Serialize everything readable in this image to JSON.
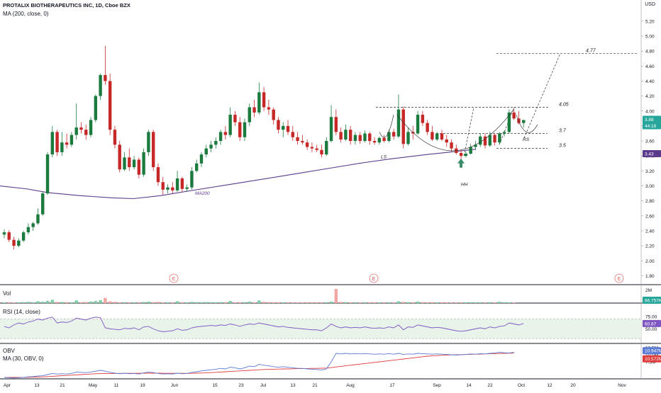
{
  "header": {
    "title": "PROTALIX BIOTHERAPEUTICS INC, 1D, Cboe BZX",
    "ma_label": "MA (200, close, 0)",
    "currency": "USD"
  },
  "panes": {
    "volume_label": "Vol",
    "rsi_label": "RSI (14, close)",
    "obv_label": "OBV",
    "obv_ma_label": "MA (30, OBV, 0)"
  },
  "colors": {
    "up": "#26a69a",
    "up_fill": "#1b7a3e",
    "down": "#ef5350",
    "down_fill": "#c62828",
    "ma200": "#5b3a8c",
    "rsi_line": "#7e57c2",
    "rsi_band": "#e8f3ea",
    "obv": "#5b7bd5",
    "obv_ma": "#e03b3b",
    "arrow": "#3a8f6a"
  },
  "chart_data": [
    {
      "type": "candlestick",
      "title": "PROTALIX BIOTHERAPEUTICS INC, 1D, Cboe BZX",
      "ylim": [
        1.7,
        5.35
      ],
      "y_ticks": [
        "5.20",
        "5.00",
        "4.80",
        "4.60",
        "4.40",
        "4.20",
        "4.00",
        "3.80",
        "3.60",
        "3.40",
        "3.20",
        "3.00",
        "2.80",
        "2.60",
        "2.40",
        "2.20",
        "2.00",
        "1.80"
      ],
      "x_ticks": [
        "Apr",
        "13",
        "21",
        "May",
        "11",
        "19",
        "Jun",
        "15",
        "23",
        "Jul",
        "13",
        "21",
        "Aug",
        "17",
        "Sep",
        "14",
        "22",
        "Oct",
        "12",
        "20",
        "Nov"
      ],
      "candles": [
        [
          2.35,
          2.42,
          2.3,
          2.38
        ],
        [
          2.38,
          2.41,
          2.25,
          2.28
        ],
        [
          2.28,
          2.32,
          2.15,
          2.2
        ],
        [
          2.2,
          2.3,
          2.18,
          2.27
        ],
        [
          2.27,
          2.4,
          2.25,
          2.38
        ],
        [
          2.38,
          2.5,
          2.35,
          2.45
        ],
        [
          2.45,
          2.52,
          2.4,
          2.5
        ],
        [
          2.5,
          2.7,
          2.48,
          2.62
        ],
        [
          2.62,
          2.92,
          2.6,
          2.9
        ],
        [
          2.9,
          3.45,
          2.88,
          3.42
        ],
        [
          3.42,
          3.8,
          3.38,
          3.72
        ],
        [
          3.72,
          3.75,
          3.4,
          3.45
        ],
        [
          3.45,
          3.72,
          3.4,
          3.58
        ],
        [
          3.58,
          3.7,
          3.5,
          3.55
        ],
        [
          3.55,
          3.72,
          3.52,
          3.68
        ],
        [
          3.68,
          4.1,
          3.62,
          3.78
        ],
        [
          3.78,
          3.85,
          3.7,
          3.75
        ],
        [
          3.75,
          3.82,
          3.62,
          3.68
        ],
        [
          3.68,
          3.92,
          3.65,
          3.88
        ],
        [
          3.88,
          4.22,
          3.85,
          4.2
        ],
        [
          4.2,
          4.5,
          4.15,
          4.48
        ],
        [
          4.48,
          4.87,
          4.35,
          4.4
        ],
        [
          4.4,
          4.5,
          3.68,
          3.75
        ],
        [
          3.75,
          3.8,
          3.5,
          3.55
        ],
        [
          3.55,
          3.6,
          3.18,
          3.22
        ],
        [
          3.22,
          3.45,
          3.2,
          3.38
        ],
        [
          3.38,
          3.5,
          3.2,
          3.25
        ],
        [
          3.25,
          3.4,
          3.22,
          3.35
        ],
        [
          3.35,
          3.38,
          3.1,
          3.15
        ],
        [
          3.15,
          3.5,
          3.12,
          3.45
        ],
        [
          3.45,
          3.75,
          3.4,
          3.72
        ],
        [
          3.72,
          3.75,
          3.2,
          3.25
        ],
        [
          3.25,
          3.3,
          3.0,
          3.05
        ],
        [
          3.05,
          3.12,
          2.88,
          2.95
        ],
        [
          2.95,
          3.02,
          2.9,
          2.98
        ],
        [
          2.98,
          3.05,
          2.9,
          2.94
        ],
        [
          2.94,
          3.2,
          2.92,
          3.1
        ],
        [
          3.1,
          3.12,
          2.92,
          2.96
        ],
        [
          2.96,
          3.02,
          2.92,
          2.98
        ],
        [
          2.98,
          3.25,
          2.95,
          3.2
        ],
        [
          3.2,
          3.35,
          3.18,
          3.3
        ],
        [
          3.3,
          3.45,
          3.25,
          3.42
        ],
        [
          3.42,
          3.55,
          3.38,
          3.5
        ],
        [
          3.5,
          3.6,
          3.45,
          3.55
        ],
        [
          3.55,
          3.65,
          3.5,
          3.6
        ],
        [
          3.6,
          3.75,
          3.55,
          3.72
        ],
        [
          3.72,
          3.8,
          3.62,
          3.68
        ],
        [
          3.68,
          4.05,
          3.65,
          3.95
        ],
        [
          3.95,
          4.0,
          3.8,
          3.85
        ],
        [
          3.85,
          3.92,
          3.6,
          3.65
        ],
        [
          3.65,
          3.9,
          3.6,
          3.85
        ],
        [
          3.85,
          4.1,
          3.8,
          4.05
        ],
        [
          4.05,
          4.15,
          3.92,
          3.98
        ],
        [
          3.98,
          4.38,
          3.95,
          4.25
        ],
        [
          4.25,
          4.32,
          4.0,
          4.05
        ],
        [
          4.05,
          4.15,
          3.95,
          4.02
        ],
        [
          4.02,
          4.05,
          3.82,
          3.88
        ],
        [
          3.88,
          3.92,
          3.7,
          3.75
        ],
        [
          3.75,
          3.85,
          3.65,
          3.8
        ],
        [
          3.8,
          3.88,
          3.68,
          3.72
        ],
        [
          3.72,
          3.8,
          3.6,
          3.65
        ],
        [
          3.65,
          3.72,
          3.55,
          3.6
        ],
        [
          3.6,
          3.68,
          3.55,
          3.58
        ],
        [
          3.58,
          3.62,
          3.48,
          3.52
        ],
        [
          3.52,
          3.58,
          3.45,
          3.5
        ],
        [
          3.5,
          3.55,
          3.45,
          3.48
        ],
        [
          3.48,
          3.55,
          3.38,
          3.42
        ],
        [
          3.42,
          3.65,
          3.4,
          3.6
        ],
        [
          3.6,
          4.08,
          3.58,
          3.92
        ],
        [
          3.92,
          4.02,
          3.68,
          3.72
        ],
        [
          3.72,
          3.78,
          3.58,
          3.62
        ],
        [
          3.62,
          3.82,
          3.6,
          3.75
        ],
        [
          3.75,
          3.8,
          3.55,
          3.6
        ],
        [
          3.6,
          3.72,
          3.55,
          3.68
        ],
        [
          3.68,
          3.72,
          3.56,
          3.6
        ],
        [
          3.6,
          3.74,
          3.58,
          3.7
        ],
        [
          3.7,
          3.72,
          3.55,
          3.6
        ],
        [
          3.6,
          3.65,
          3.55,
          3.58
        ],
        [
          3.58,
          3.66,
          3.55,
          3.64
        ],
        [
          3.64,
          3.68,
          3.58,
          3.6
        ],
        [
          3.6,
          3.75,
          3.58,
          3.72
        ],
        [
          3.72,
          3.76,
          3.62,
          3.66
        ],
        [
          3.66,
          4.22,
          3.64,
          4.02
        ],
        [
          4.02,
          4.06,
          3.5,
          3.56
        ],
        [
          3.56,
          3.78,
          3.54,
          3.72
        ],
        [
          3.72,
          3.8,
          3.62,
          3.7
        ],
        [
          3.7,
          4.0,
          3.68,
          3.95
        ],
        [
          3.95,
          4.0,
          3.8,
          3.84
        ],
        [
          3.84,
          3.88,
          3.68,
          3.72
        ],
        [
          3.72,
          3.8,
          3.6,
          3.62
        ],
        [
          3.62,
          3.72,
          3.6,
          3.7
        ],
        [
          3.7,
          3.75,
          3.6,
          3.62
        ],
        [
          3.62,
          3.68,
          3.52,
          3.58
        ],
        [
          3.58,
          3.62,
          3.46,
          3.5
        ],
        [
          3.5,
          3.55,
          3.42,
          3.44
        ],
        [
          3.44,
          3.48,
          3.36,
          3.4
        ],
        [
          3.4,
          3.46,
          3.38,
          3.43
        ],
        [
          3.43,
          3.56,
          3.42,
          3.52
        ],
        [
          3.52,
          3.6,
          3.48,
          3.55
        ],
        [
          3.55,
          3.7,
          3.52,
          3.66
        ],
        [
          3.66,
          3.7,
          3.5,
          3.54
        ],
        [
          3.54,
          3.72,
          3.52,
          3.68
        ],
        [
          3.68,
          3.7,
          3.54,
          3.58
        ],
        [
          3.58,
          3.72,
          3.56,
          3.7
        ],
        [
          3.7,
          3.74,
          3.66,
          3.72
        ],
        [
          3.72,
          4.02,
          3.7,
          3.98
        ],
        [
          3.98,
          4.02,
          3.88,
          3.9
        ],
        [
          3.9,
          4.0,
          3.82,
          3.84
        ],
        [
          3.84,
          3.88,
          3.78,
          3.88
        ]
      ],
      "ma200": [
        [
          0,
          3.0
        ],
        [
          0.05,
          2.96
        ],
        [
          0.09,
          2.91
        ],
        [
          0.15,
          2.87
        ],
        [
          0.21,
          2.84
        ],
        [
          0.25,
          2.83
        ],
        [
          0.3,
          2.87
        ],
        [
          0.36,
          2.94
        ],
        [
          0.43,
          3.02
        ],
        [
          0.5,
          3.1
        ],
        [
          0.56,
          3.17
        ],
        [
          0.62,
          3.24
        ],
        [
          0.68,
          3.31
        ],
        [
          0.73,
          3.36
        ],
        [
          0.8,
          3.42
        ],
        [
          0.84,
          3.45
        ],
        [
          0.89,
          3.49
        ]
      ],
      "ma200_label": "MA200",
      "last_price": "3.88",
      "countdown": "44:18",
      "ma_value": "3.43",
      "levels": [
        {
          "label": "4.77",
          "value": 4.77
        },
        {
          "label": "4.05",
          "value": 4.05
        },
        {
          "label": "3.7",
          "value": 3.7
        },
        {
          "label": "3.5",
          "value": 3.5
        }
      ],
      "pattern_labels": {
        "left_shoulder": "LS",
        "head": "HH",
        "right_shoulder": "RS"
      },
      "earnings_marker": "E"
    },
    {
      "type": "bar",
      "title": "Vol",
      "axis_label": "2M",
      "last_value": "66.757K",
      "values": [
        0.05,
        0.06,
        0.04,
        0.05,
        0.06,
        0.08,
        0.05,
        0.12,
        0.09,
        0.15,
        0.22,
        0.08,
        0.07,
        0.06,
        0.05,
        0.18,
        0.06,
        0.07,
        0.1,
        0.14,
        0.2,
        0.35,
        0.12,
        0.08,
        0.05,
        0.06,
        0.05,
        0.05,
        0.06,
        0.07,
        0.1,
        0.06,
        0.08,
        0.05,
        0.04,
        0.05,
        0.12,
        0.05,
        0.05,
        0.08,
        0.06,
        0.06,
        0.07,
        0.06,
        0.05,
        0.06,
        0.05,
        0.14,
        0.05,
        0.06,
        0.06,
        0.1,
        0.05,
        0.18,
        0.08,
        0.06,
        0.05,
        0.05,
        0.04,
        0.05,
        0.04,
        0.05,
        0.04,
        0.04,
        0.05,
        0.04,
        0.05,
        0.06,
        0.1,
        0.95,
        0.08,
        0.06,
        0.05,
        0.04,
        0.04,
        0.05,
        0.04,
        0.04,
        0.05,
        0.04,
        0.05,
        0.04,
        0.12,
        0.08,
        0.06,
        0.05,
        0.1,
        0.06,
        0.05,
        0.06,
        0.05,
        0.05,
        0.04,
        0.05,
        0.04,
        0.05,
        0.05,
        0.06,
        0.05,
        0.06,
        0.05,
        0.06,
        0.05,
        0.09,
        0.06,
        0.05,
        0.04
      ]
    },
    {
      "type": "line",
      "title": "RSI (14, close)",
      "y_ticks": [
        "75.00",
        "50.00"
      ],
      "last_value": "60.87",
      "band": [
        30,
        70
      ],
      "values": [
        55,
        52,
        58,
        62,
        60,
        64,
        66,
        70,
        68,
        72,
        74,
        62,
        64,
        63,
        66,
        72,
        70,
        68,
        72,
        74,
        73,
        52,
        50,
        49,
        48,
        51,
        50,
        52,
        48,
        54,
        55,
        50,
        46,
        44,
        45,
        46,
        50,
        47,
        48,
        52,
        54,
        55,
        56,
        57,
        56,
        58,
        57,
        60,
        58,
        55,
        58,
        60,
        59,
        62,
        60,
        58,
        56,
        54,
        55,
        53,
        52,
        51,
        50,
        49,
        48,
        48,
        46,
        52,
        60,
        55,
        52,
        54,
        52,
        53,
        52,
        54,
        52,
        51,
        52,
        51,
        54,
        52,
        58,
        48,
        54,
        53,
        58,
        56,
        54,
        52,
        53,
        52,
        50,
        48,
        46,
        45,
        46,
        48,
        50,
        52,
        50,
        54,
        52,
        55,
        56,
        62,
        60,
        58,
        61
      ]
    },
    {
      "type": "line",
      "title": "OBV",
      "y_ticks": [
        "12.5M",
        "10.0M",
        "7.5M"
      ],
      "obv_value": "10.947M",
      "obv_ma_value": "10.572M",
      "obv": [
        2.0,
        1.9,
        1.8,
        1.9,
        2.0,
        2.2,
        2.3,
        2.5,
        2.6,
        3.0,
        3.4,
        3.2,
        3.3,
        3.2,
        3.4,
        3.9,
        3.8,
        3.7,
        3.9,
        4.2,
        4.5,
        4.2,
        3.8,
        3.5,
        3.3,
        3.5,
        3.3,
        3.4,
        3.2,
        3.6,
        3.9,
        3.7,
        3.4,
        3.2,
        3.3,
        3.2,
        3.5,
        3.3,
        3.4,
        3.8,
        4.0,
        4.3,
        4.5,
        4.7,
        4.9,
        5.2,
        5.0,
        5.6,
        5.4,
        5.0,
        5.4,
        6.0,
        5.8,
        6.6,
        6.3,
        6.1,
        5.8,
        5.6,
        5.8,
        5.6,
        5.4,
        5.2,
        5.2,
        5.0,
        4.9,
        4.8,
        4.6,
        5.0,
        7.5,
        10.5,
        10.3,
        10.5,
        10.3,
        10.4,
        10.3,
        10.4,
        10.3,
        10.2,
        10.3,
        10.2,
        10.4,
        10.2,
        10.5,
        10.1,
        10.3,
        10.2,
        10.5,
        10.4,
        10.3,
        10.2,
        10.3,
        10.2,
        10.1,
        10.0,
        9.9,
        10.0,
        10.1,
        10.3,
        10.2,
        10.4,
        10.3,
        10.5,
        10.6,
        10.9,
        10.7,
        10.6,
        10.9
      ],
      "obv_ma": [
        2.0,
        2.0,
        2.0,
        2.0,
        2.0,
        2.05,
        2.1,
        2.15,
        2.2,
        2.3,
        2.4,
        2.5,
        2.6,
        2.7,
        2.8,
        2.9,
        3.0,
        3.1,
        3.2,
        3.3,
        3.35,
        3.4,
        3.4,
        3.4,
        3.42,
        3.44,
        3.45,
        3.46,
        3.47,
        3.48,
        3.5,
        3.5,
        3.5,
        3.48,
        3.46,
        3.45,
        3.45,
        3.44,
        3.43,
        3.45,
        3.5,
        3.55,
        3.6,
        3.7,
        3.8,
        3.9,
        4.0,
        4.1,
        4.2,
        4.3,
        4.4,
        4.5,
        4.6,
        4.7,
        4.8,
        4.85,
        4.9,
        4.95,
        5.0,
        5.0,
        5.05,
        5.1,
        5.1,
        5.15,
        5.2,
        5.2,
        5.25,
        5.3,
        5.45,
        5.7,
        5.9,
        6.1,
        6.3,
        6.5,
        6.7,
        6.9,
        7.1,
        7.3,
        7.5,
        7.7,
        7.9,
        8.1,
        8.3,
        8.5,
        8.7,
        8.9,
        9.1,
        9.3,
        9.5,
        9.6,
        9.7,
        9.8,
        9.9,
        9.95,
        10.0,
        10.05,
        10.1,
        10.15,
        10.2,
        10.25,
        10.3,
        10.35,
        10.4,
        10.45,
        10.5,
        10.55,
        10.57
      ]
    }
  ]
}
